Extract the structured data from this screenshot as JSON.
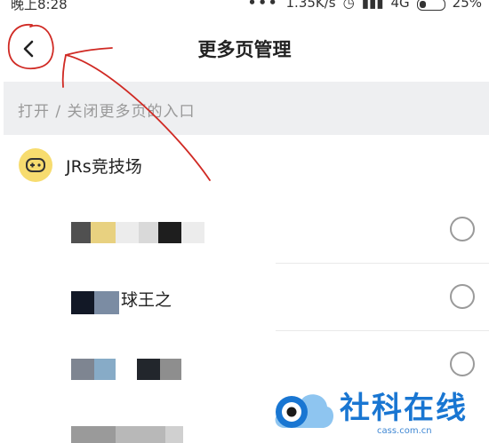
{
  "status_bar": {
    "time": "晚上8:28",
    "network_speed": "1.35K/s",
    "network_type": "4G",
    "battery": "25%"
  },
  "header": {
    "title": "更多页管理",
    "back_icon": "chevron-left-icon"
  },
  "section": {
    "label": "打开 / 关闭更多页的入口"
  },
  "group": {
    "label": "JRs竞技场",
    "icon": "gamepad-icon"
  },
  "rows": [
    {
      "name": "",
      "selected": false
    },
    {
      "name": "球王之",
      "selected": false
    },
    {
      "name": "",
      "selected": false
    }
  ],
  "watermark": {
    "text": "社科在线",
    "url": "cass.com.cn"
  },
  "colors": {
    "accent_red_annotation": "#d02a24",
    "group_icon_bg": "#f7dc6f",
    "watermark_blue": "#1976d2"
  }
}
